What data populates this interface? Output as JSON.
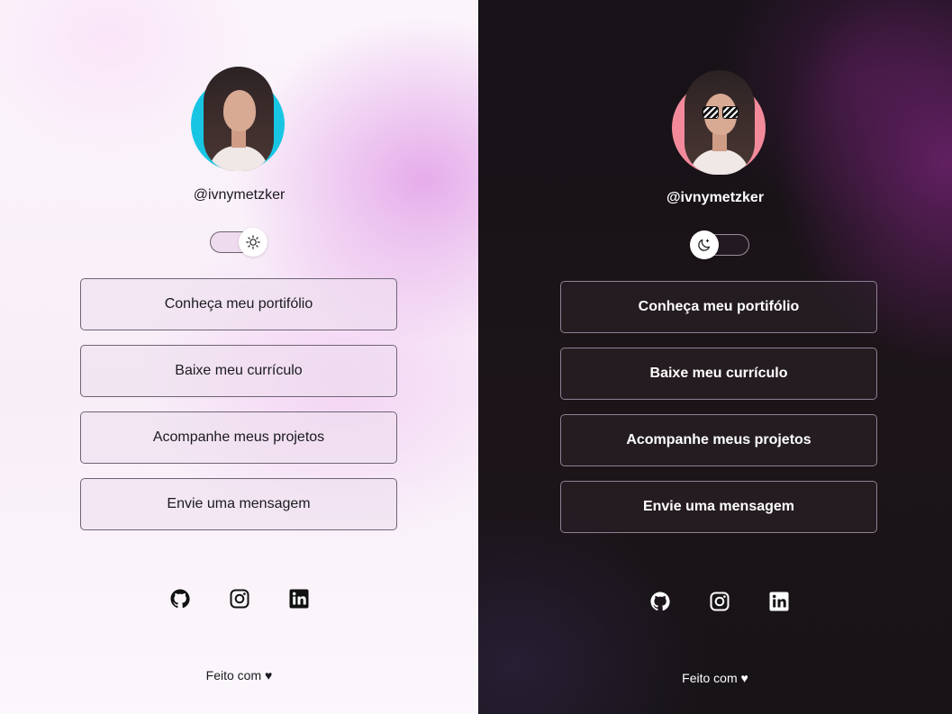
{
  "light": {
    "username": "@ivnymetzker",
    "theme_icon": "sun-icon",
    "links": [
      {
        "label": "Conheça meu portifólio"
      },
      {
        "label": "Baixe meu currículo"
      },
      {
        "label": "Acompanhe meus projetos"
      },
      {
        "label": "Envie uma mensagem"
      }
    ],
    "socials": [
      "github-icon",
      "instagram-icon",
      "linkedin-icon"
    ],
    "footer": "Feito com ♥",
    "colors": {
      "avatar_bg": "#18c6e4",
      "accent": "#e2a0e8"
    }
  },
  "dark": {
    "username": "@ivnymetzker",
    "theme_icon": "moon-icon",
    "links": [
      {
        "label": "Conheça meu portifólio"
      },
      {
        "label": "Baixe meu currículo"
      },
      {
        "label": "Acompanhe meus projetos"
      },
      {
        "label": "Envie uma mensagem"
      }
    ],
    "socials": [
      "github-icon",
      "instagram-icon",
      "linkedin-icon"
    ],
    "footer": "Feito com ♥",
    "colors": {
      "avatar_bg": "#f28a9b",
      "accent": "#6e226e"
    }
  }
}
